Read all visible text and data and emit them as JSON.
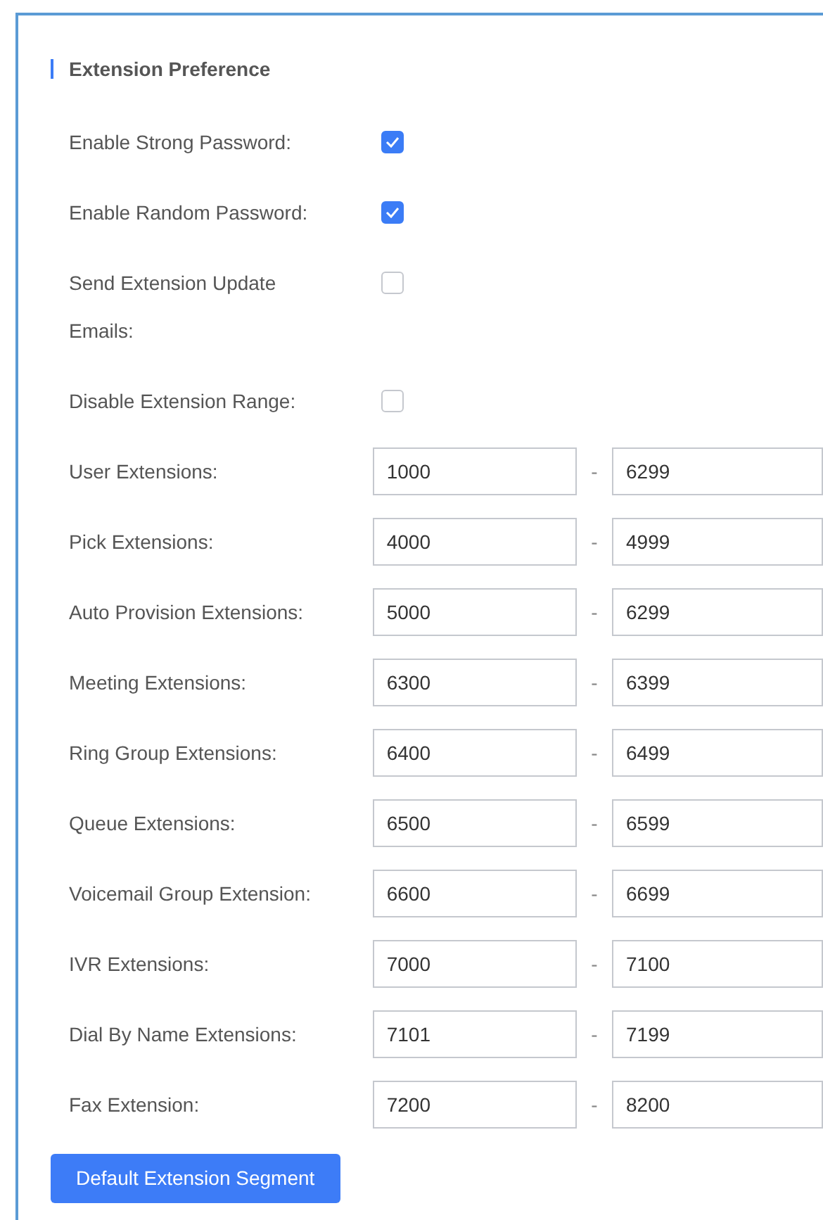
{
  "section": {
    "title": "Extension Preference"
  },
  "options": [
    {
      "kind": "checkbox",
      "label": "Enable Strong Password:",
      "checked": true
    },
    {
      "kind": "checkbox",
      "label": "Enable Random Password:",
      "checked": true
    },
    {
      "kind": "checkbox",
      "label": "Send Extension Update Emails:",
      "checked": false
    },
    {
      "kind": "checkbox",
      "label": "Disable Extension Range:",
      "checked": false
    },
    {
      "kind": "range",
      "label": "User Extensions:",
      "from": "1000",
      "separator": "-",
      "to": "6299"
    },
    {
      "kind": "range",
      "label": "Pick Extensions:",
      "from": "4000",
      "separator": "-",
      "to": "4999"
    },
    {
      "kind": "range",
      "label": "Auto Provision Extensions:",
      "from": "5000",
      "separator": "-",
      "to": "6299"
    },
    {
      "kind": "range",
      "label": "Meeting Extensions:",
      "from": "6300",
      "separator": "-",
      "to": "6399"
    },
    {
      "kind": "range",
      "label": "Ring Group Extensions:",
      "from": "6400",
      "separator": "-",
      "to": "6499"
    },
    {
      "kind": "range",
      "label": "Queue Extensions:",
      "from": "6500",
      "separator": "-",
      "to": "6599"
    },
    {
      "kind": "range",
      "label": "Voicemail Group Extension:",
      "from": "6600",
      "separator": "-",
      "to": "6699"
    },
    {
      "kind": "range",
      "label": "IVR Extensions:",
      "from": "7000",
      "separator": "-",
      "to": "7100"
    },
    {
      "kind": "range",
      "label": "Dial By Name Extensions:",
      "from": "7101",
      "separator": "-",
      "to": "7199"
    },
    {
      "kind": "range",
      "label": "Fax Extension:",
      "from": "7200",
      "separator": "-",
      "to": "8200"
    }
  ],
  "button": {
    "label": "Default Extension Segment"
  }
}
